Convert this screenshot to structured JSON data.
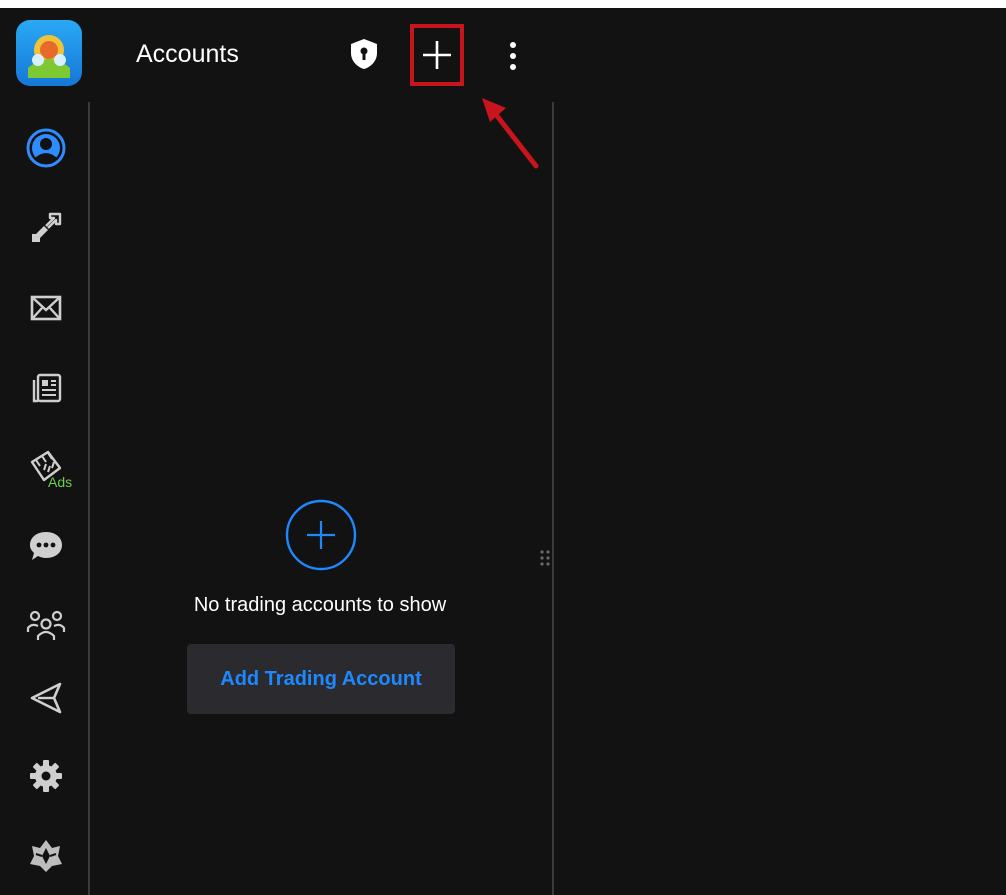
{
  "header": {
    "title": "Accounts",
    "actions": [
      {
        "name": "shield-icon"
      },
      {
        "name": "plus-icon"
      },
      {
        "name": "more-vert-icon"
      }
    ]
  },
  "sidebar": {
    "items": [
      {
        "name": "accounts",
        "icon": "user-circle-icon",
        "active": true
      },
      {
        "name": "trade",
        "icon": "trade-arrows-icon"
      },
      {
        "name": "mailbox",
        "icon": "envelope-icon"
      },
      {
        "name": "news",
        "icon": "newspaper-icon"
      },
      {
        "name": "ads",
        "icon": "calendar-ads-icon",
        "badge": "Ads"
      },
      {
        "name": "chats",
        "icon": "chat-bubble-icon"
      },
      {
        "name": "community",
        "icon": "people-icon"
      },
      {
        "name": "telegram",
        "icon": "paper-plane-icon"
      },
      {
        "name": "settings",
        "icon": "gear-icon"
      },
      {
        "name": "about",
        "icon": "crown-logo-icon"
      }
    ]
  },
  "main": {
    "empty_message": "No trading accounts to show",
    "add_button_label": "Add Trading Account"
  },
  "colors": {
    "background": "#121212",
    "accent": "#1e88ff",
    "annotation": "#c8141c",
    "ads_green": "#6bd04a"
  }
}
